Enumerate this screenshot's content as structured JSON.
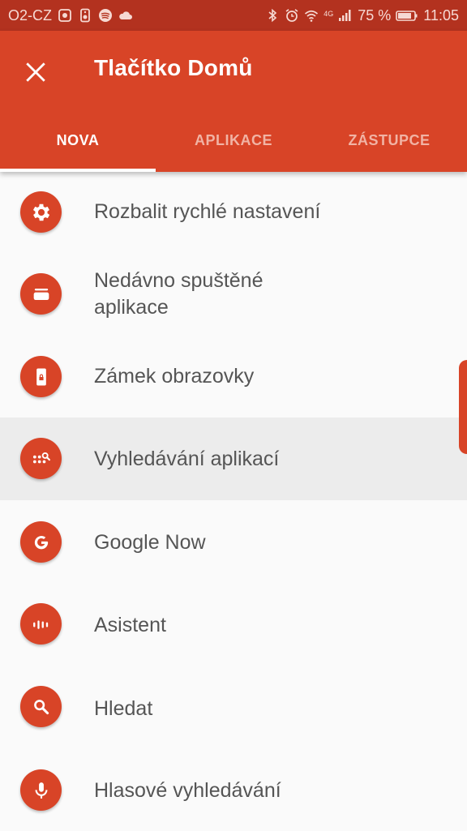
{
  "status_bar": {
    "carrier": "O2-CZ",
    "network": "4G",
    "battery": "75 %",
    "time": "11:05"
  },
  "app_bar": {
    "close_icon": "close-icon",
    "title": "Tlačítko Domů"
  },
  "tabs": [
    {
      "label": "NOVA",
      "active": true
    },
    {
      "label": "APLIKACE",
      "active": false
    },
    {
      "label": "ZÁSTUPCE",
      "active": false
    }
  ],
  "list": {
    "items": [
      {
        "label": "Rozbalit rychlé nastavení",
        "icon": "gear-icon"
      },
      {
        "label": "Nedávno spuštěné aplikace",
        "line1": "Nedávno spuštěné",
        "line2": "aplikace",
        "icon": "recent-apps-icon"
      },
      {
        "label": "Zámek obrazovky",
        "icon": "lock-screen-icon"
      },
      {
        "label": "Vyhledávání aplikací",
        "icon": "app-search-icon",
        "selected": true
      },
      {
        "label": "Google Now",
        "icon": "google-icon"
      },
      {
        "label": "Asistent",
        "icon": "assistant-icon"
      },
      {
        "label": "Hledat",
        "icon": "search-icon"
      },
      {
        "label": "Hlasové vyhledávání",
        "icon": "microphone-icon"
      }
    ]
  },
  "colors": {
    "status_bar": "#b3321f",
    "accent": "#d84427",
    "selected_row": "#ececec",
    "text": "#555555"
  }
}
